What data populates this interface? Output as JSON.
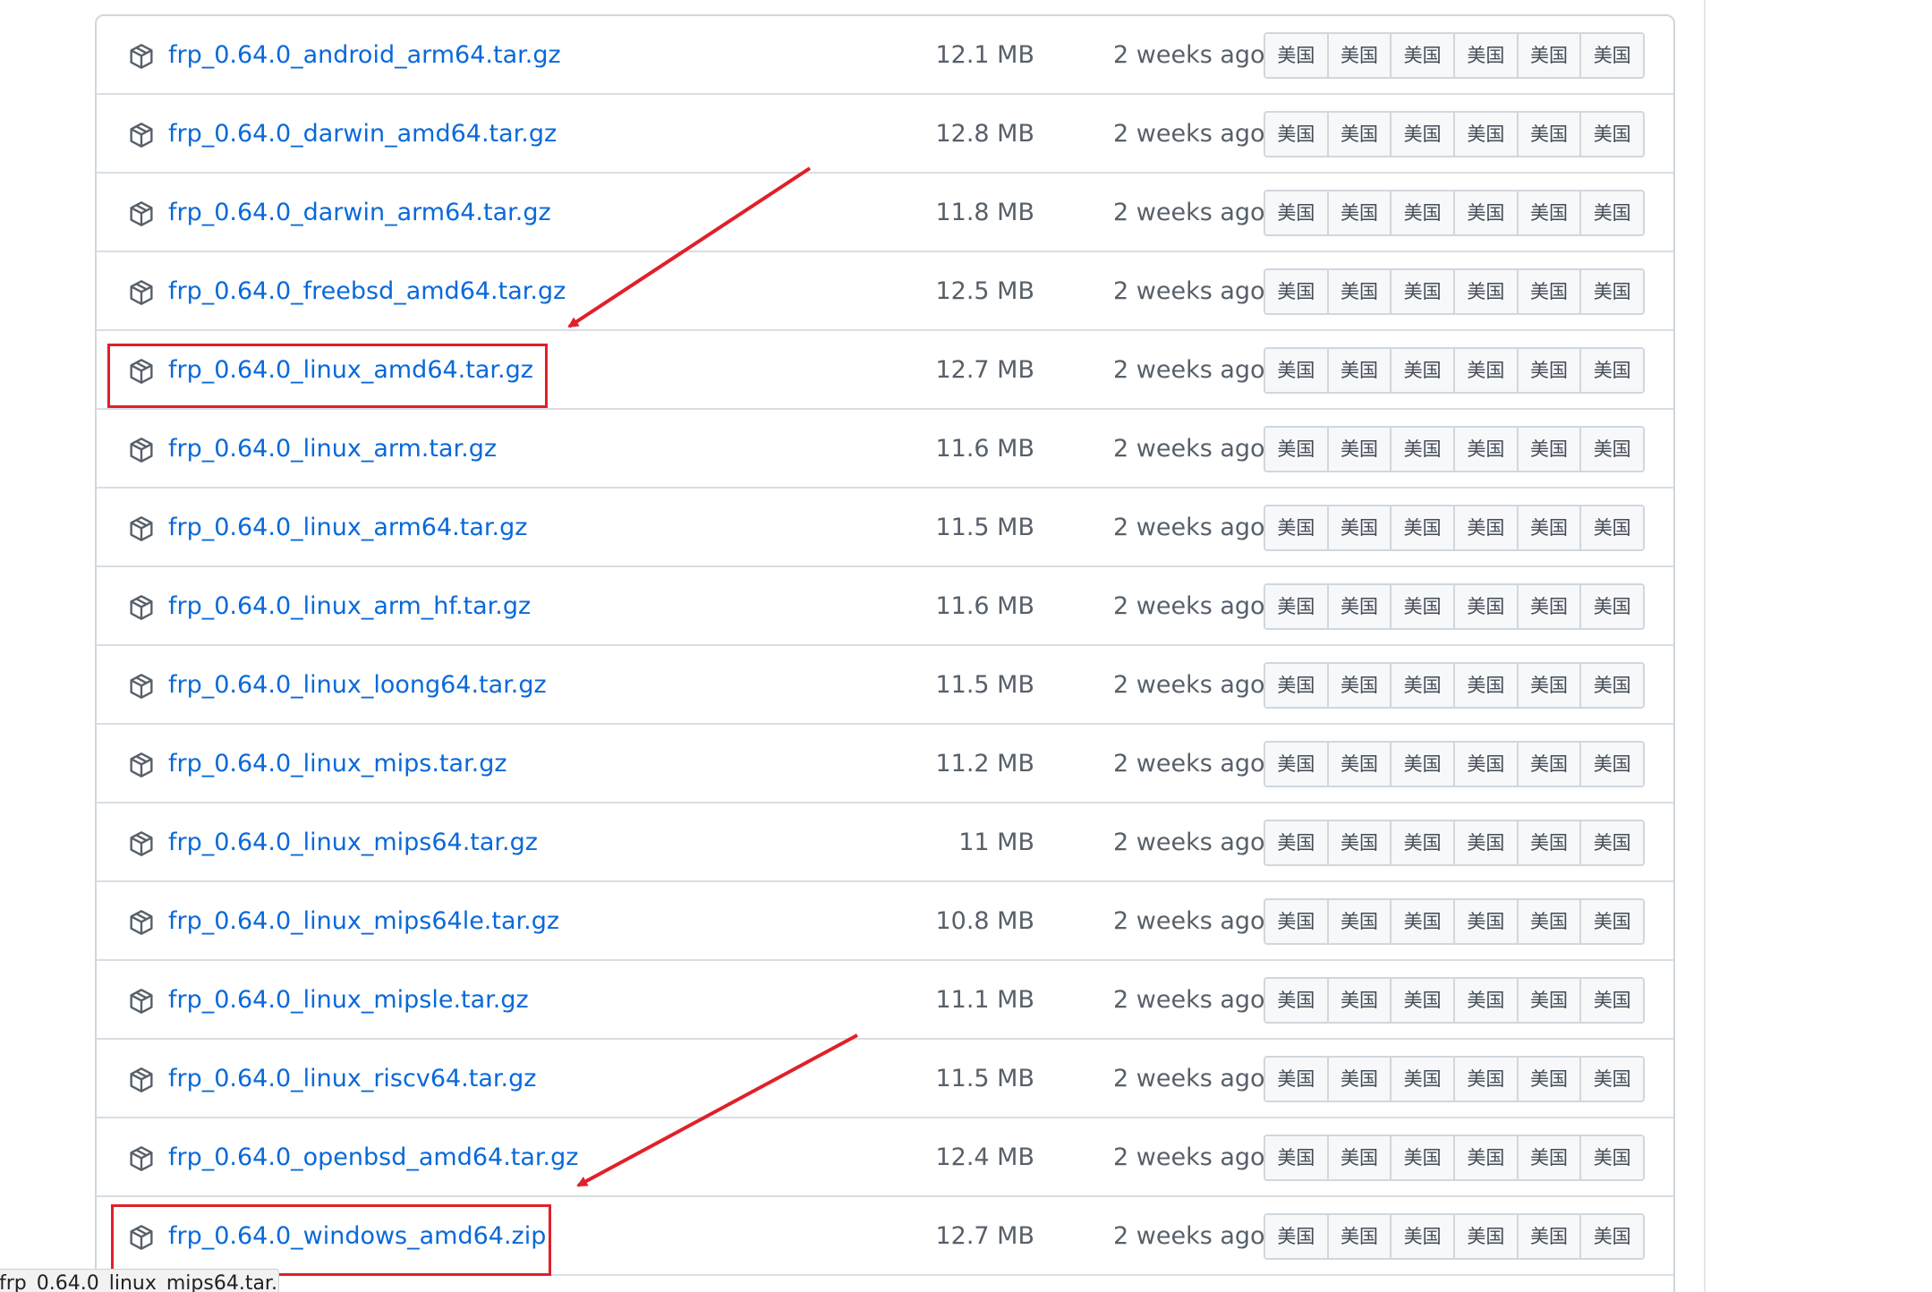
{
  "assets": [
    {
      "name": "frp_0.64.0_android_arm64.tar.gz",
      "size": "12.1 MB",
      "time": "2 weeks ago"
    },
    {
      "name": "frp_0.64.0_darwin_amd64.tar.gz",
      "size": "12.8 MB",
      "time": "2 weeks ago"
    },
    {
      "name": "frp_0.64.0_darwin_arm64.tar.gz",
      "size": "11.8 MB",
      "time": "2 weeks ago"
    },
    {
      "name": "frp_0.64.0_freebsd_amd64.tar.gz",
      "size": "12.5 MB",
      "time": "2 weeks ago"
    },
    {
      "name": "frp_0.64.0_linux_amd64.tar.gz",
      "size": "12.7 MB",
      "time": "2 weeks ago"
    },
    {
      "name": "frp_0.64.0_linux_arm.tar.gz",
      "size": "11.6 MB",
      "time": "2 weeks ago"
    },
    {
      "name": "frp_0.64.0_linux_arm64.tar.gz",
      "size": "11.5 MB",
      "time": "2 weeks ago"
    },
    {
      "name": "frp_0.64.0_linux_arm_hf.tar.gz",
      "size": "11.6 MB",
      "time": "2 weeks ago"
    },
    {
      "name": "frp_0.64.0_linux_loong64.tar.gz",
      "size": "11.5 MB",
      "time": "2 weeks ago"
    },
    {
      "name": "frp_0.64.0_linux_mips.tar.gz",
      "size": "11.2 MB",
      "time": "2 weeks ago"
    },
    {
      "name": "frp_0.64.0_linux_mips64.tar.gz",
      "size": "11 MB",
      "time": "2 weeks ago"
    },
    {
      "name": "frp_0.64.0_linux_mips64le.tar.gz",
      "size": "10.8 MB",
      "time": "2 weeks ago"
    },
    {
      "name": "frp_0.64.0_linux_mipsle.tar.gz",
      "size": "11.1 MB",
      "time": "2 weeks ago"
    },
    {
      "name": "frp_0.64.0_linux_riscv64.tar.gz",
      "size": "11.5 MB",
      "time": "2 weeks ago"
    },
    {
      "name": "frp_0.64.0_openbsd_amd64.tar.gz",
      "size": "12.4 MB",
      "time": "2 weeks ago"
    },
    {
      "name": "frp_0.64.0_windows_amd64.zip",
      "size": "12.7 MB",
      "time": "2 weeks ago"
    }
  ],
  "mirror_labels": [
    "美国",
    "美国",
    "美国",
    "美国",
    "美国",
    "美国"
  ],
  "icons": {
    "asset": "package-icon"
  },
  "colors": {
    "link": "#0969da",
    "annotation": "#e0202a"
  },
  "status_bar": {
    "text": "frp_0.64.0_linux_mips64.tar...."
  }
}
